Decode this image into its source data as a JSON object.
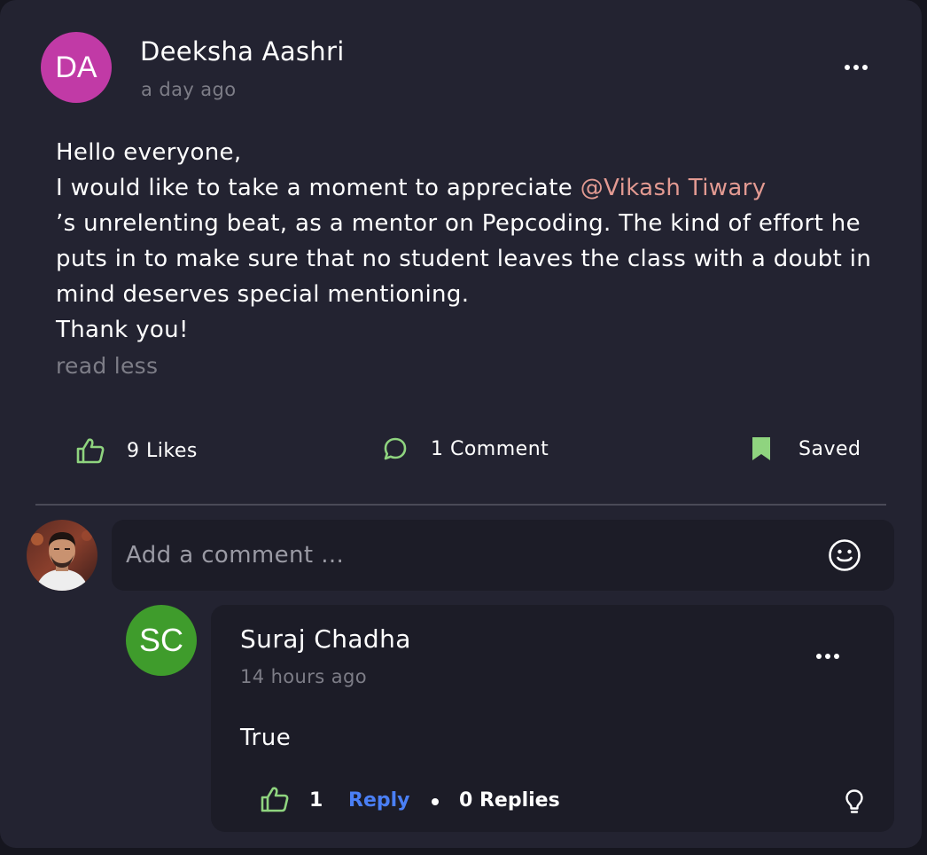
{
  "post": {
    "author_initials": "DA",
    "author_name": "Deeksha Aashri",
    "time": "a day ago",
    "body_line1": "Hello everyone,",
    "body_line2_prefix": "I would like to take a moment to appreciate ",
    "mention": "@Vikash Tiwary",
    "body_rest": "’s unrelenting beat, as a mentor on Pepcoding. The kind of effort he puts in to make sure that no student leaves the class with a doubt in mind deserves special mentioning.",
    "body_last": "Thank you!",
    "read_less": "read less"
  },
  "actions": {
    "likes": "9 Likes",
    "comments": "1 Comment",
    "saved": "Saved"
  },
  "comment_input": {
    "placeholder": "Add a comment ..."
  },
  "reply": {
    "author_initials": "SC",
    "author_name": "Suraj Chadha",
    "time": "14 hours ago",
    "text": "True",
    "like_count": "1",
    "reply_label": "Reply",
    "replies_count": "0 Replies"
  },
  "colors": {
    "card_bg": "#232331",
    "accent_green": "#8fd47f",
    "mention": "#e39a92",
    "link_blue": "#4a7ff5",
    "avatar_da": "#c13aa6",
    "avatar_sc": "#3f9c2c"
  },
  "icons": {
    "like": "thumbs-up-icon",
    "comment": "chat-bubble-icon",
    "saved": "bookmark-icon",
    "emoji": "smiley-icon",
    "more": "more-dots-icon",
    "idea": "lightbulb-icon"
  }
}
